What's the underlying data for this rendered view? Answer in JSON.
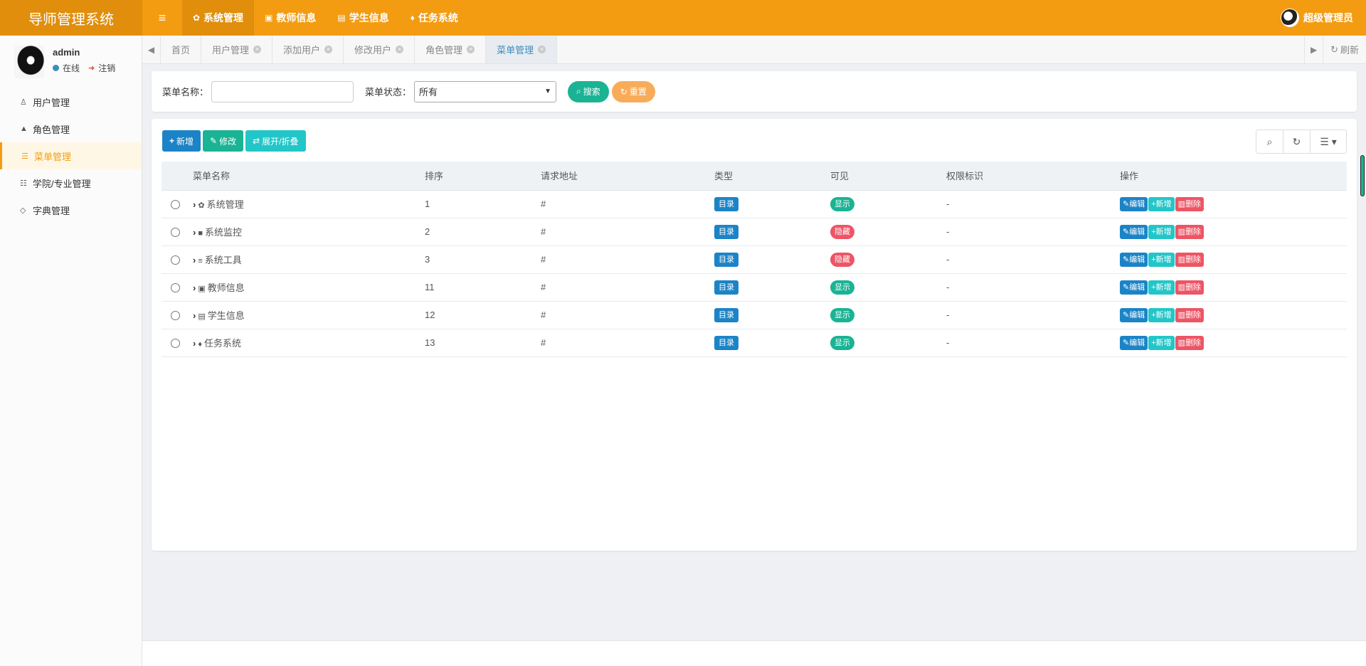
{
  "app": {
    "title": "导师管理系统",
    "user": "超级管理员"
  },
  "topnav": [
    {
      "icon": "gear-icon",
      "glyph": "✿",
      "label": "系统管理",
      "active": true
    },
    {
      "icon": "id-badge-icon",
      "glyph": "▣",
      "label": "教师信息",
      "active": false
    },
    {
      "icon": "id-card-icon",
      "glyph": "▤",
      "label": "学生信息",
      "active": false
    },
    {
      "icon": "tint-icon",
      "glyph": "♦",
      "label": "任务系统",
      "active": false
    }
  ],
  "sidebar": {
    "username": "admin",
    "status": "在线",
    "logout": "注销",
    "items": [
      {
        "icon": "user-icon",
        "glyph": "♙",
        "label": "用户管理"
      },
      {
        "icon": "lock-icon",
        "glyph": "▲",
        "label": "角色管理"
      },
      {
        "icon": "list-icon",
        "glyph": "☰",
        "label": "菜单管理",
        "active": true
      },
      {
        "icon": "outdent-icon",
        "glyph": "☷",
        "label": "学院/专业管理"
      },
      {
        "icon": "bookmark-icon",
        "glyph": "◇",
        "label": "字典管理"
      }
    ]
  },
  "tabs": {
    "items": [
      {
        "label": "首页",
        "closable": false
      },
      {
        "label": "用户管理",
        "closable": true
      },
      {
        "label": "添加用户",
        "closable": true
      },
      {
        "label": "修改用户",
        "closable": true
      },
      {
        "label": "角色管理",
        "closable": true
      },
      {
        "label": "菜单管理",
        "closable": true,
        "active": true
      }
    ],
    "refresh": "刷新"
  },
  "search": {
    "name_label": "菜单名称：",
    "name_value": "",
    "status_label": "菜单状态：",
    "status_value": "所有",
    "search_btn": "搜索",
    "reset_btn": "重置"
  },
  "toolbar": {
    "add": "新增",
    "edit": "修改",
    "expand": "展开/折叠"
  },
  "table": {
    "columns": [
      "菜单名称",
      "排序",
      "请求地址",
      "类型",
      "可见",
      "权限标识",
      "操作"
    ],
    "rows": [
      {
        "icon": "gear-icon",
        "glyph": "✿",
        "name": "系统管理",
        "order": "1",
        "url": "#",
        "type": "目录",
        "visible": "显示",
        "perm": "-"
      },
      {
        "icon": "video-icon",
        "glyph": "■",
        "name": "系统监控",
        "order": "2",
        "url": "#",
        "type": "目录",
        "visible": "隐藏",
        "perm": "-"
      },
      {
        "icon": "bars-icon",
        "glyph": "≡",
        "name": "系统工具",
        "order": "3",
        "url": "#",
        "type": "目录",
        "visible": "隐藏",
        "perm": "-"
      },
      {
        "icon": "id-badge-icon",
        "glyph": "▣",
        "name": "教师信息",
        "order": "11",
        "url": "#",
        "type": "目录",
        "visible": "显示",
        "perm": "-"
      },
      {
        "icon": "id-card-icon",
        "glyph": "▤",
        "name": "学生信息",
        "order": "12",
        "url": "#",
        "type": "目录",
        "visible": "显示",
        "perm": "-"
      },
      {
        "icon": "tint-icon",
        "glyph": "♦",
        "name": "任务系统",
        "order": "13",
        "url": "#",
        "type": "目录",
        "visible": "显示",
        "perm": "-"
      }
    ],
    "actions": {
      "edit": "编辑",
      "add": "新增",
      "delete": "删除"
    }
  },
  "colors": {
    "brand": "#f39c12",
    "primary": "#1c84c6",
    "success": "#1ab394",
    "danger": "#ed5565",
    "info": "#23c6c8"
  }
}
